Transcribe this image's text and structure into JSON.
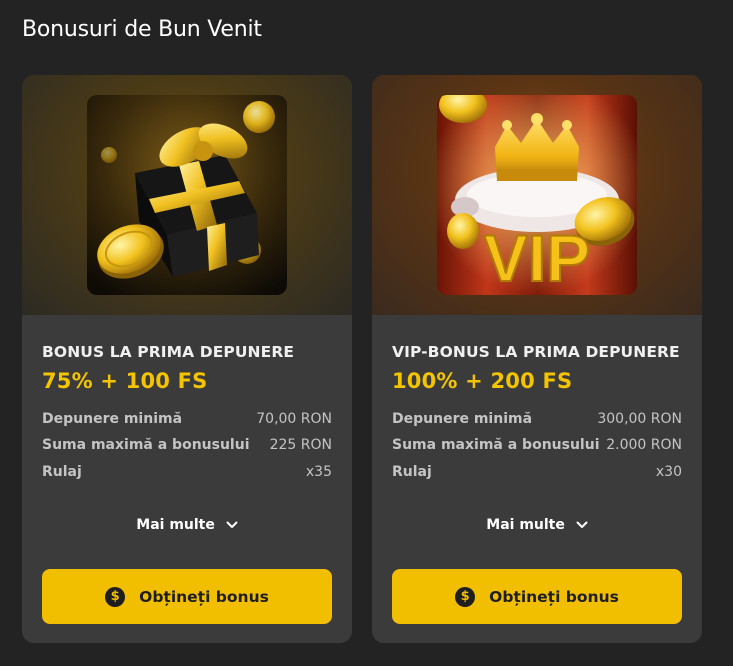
{
  "page": {
    "title": "Bonusuri de Bun Venit"
  },
  "cards": [
    {
      "art": "gift-box-with-gold-coins",
      "title": "BONUS LA PRIMA DEPUNERE",
      "offer": "75% + 100 FS",
      "details": [
        {
          "label": "Depunere minimă",
          "value": "70,00 RON"
        },
        {
          "label": "Suma maximă a bonusului",
          "value": "225 RON"
        },
        {
          "label": "Rulaj",
          "value": "x35"
        }
      ],
      "more_label": "Mai multe",
      "cta_label": "Obțineți bonus",
      "cta_icon": "dollar-coin-icon"
    },
    {
      "art": "vip-crown-on-pillow",
      "art_text": "VIP",
      "title": "VIP-BONUS LA PRIMA DEPUNERE",
      "offer": "100% + 200 FS",
      "details": [
        {
          "label": "Depunere minimă",
          "value": "300,00 RON"
        },
        {
          "label": "Suma maximă a bonusului",
          "value": "2.000 RON"
        },
        {
          "label": "Rulaj",
          "value": "x30"
        }
      ],
      "more_label": "Mai multe",
      "cta_label": "Obțineți bonus",
      "cta_icon": "dollar-coin-icon"
    }
  ],
  "colors": {
    "accent": "#f2bf00",
    "card_bg": "#3b3b3b",
    "page_bg": "#232323",
    "offer_text": "#f5c400"
  }
}
